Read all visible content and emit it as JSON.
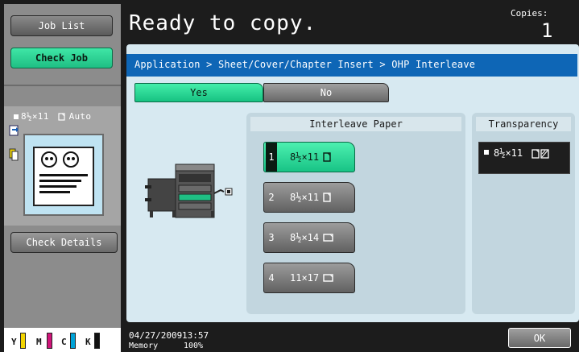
{
  "header": {
    "status": "Ready to copy.",
    "copies_label": "Copies:",
    "copies_value": "1"
  },
  "left": {
    "job_list": "Job List",
    "check_job": "Check Job",
    "paper_size": "8½×11",
    "paper_mode": "Auto",
    "check_details": "Check Details",
    "toner": [
      "Y",
      "M",
      "C",
      "K"
    ],
    "toner_colors": [
      "#f2d400",
      "#d0157a",
      "#00a3d8",
      "#111111"
    ]
  },
  "breadcrumb": "Application > Sheet/Cover/Chapter Insert > OHP Interleave",
  "toggle": {
    "yes": "Yes",
    "no": "No",
    "selected": "Yes"
  },
  "interleave": {
    "header": "Interleave Paper",
    "trays": [
      {
        "num": "1",
        "size": "8½×11",
        "selected": true
      },
      {
        "num": "2",
        "size": "8½×11",
        "selected": false
      },
      {
        "num": "3",
        "size": "8½×14",
        "selected": false
      },
      {
        "num": "4",
        "size": "11×17",
        "selected": false
      }
    ]
  },
  "transparency": {
    "header": "Transparency",
    "size": "8½×11"
  },
  "footer": {
    "date": "04/27/2009",
    "time": "13:57",
    "memory_label": "Memory",
    "memory_value": "100%",
    "ok": "OK"
  },
  "colors": {
    "accent_green": "#1fbf84",
    "bar_blue": "#0e66b6",
    "panel_bg": "#d7e9f1"
  }
}
